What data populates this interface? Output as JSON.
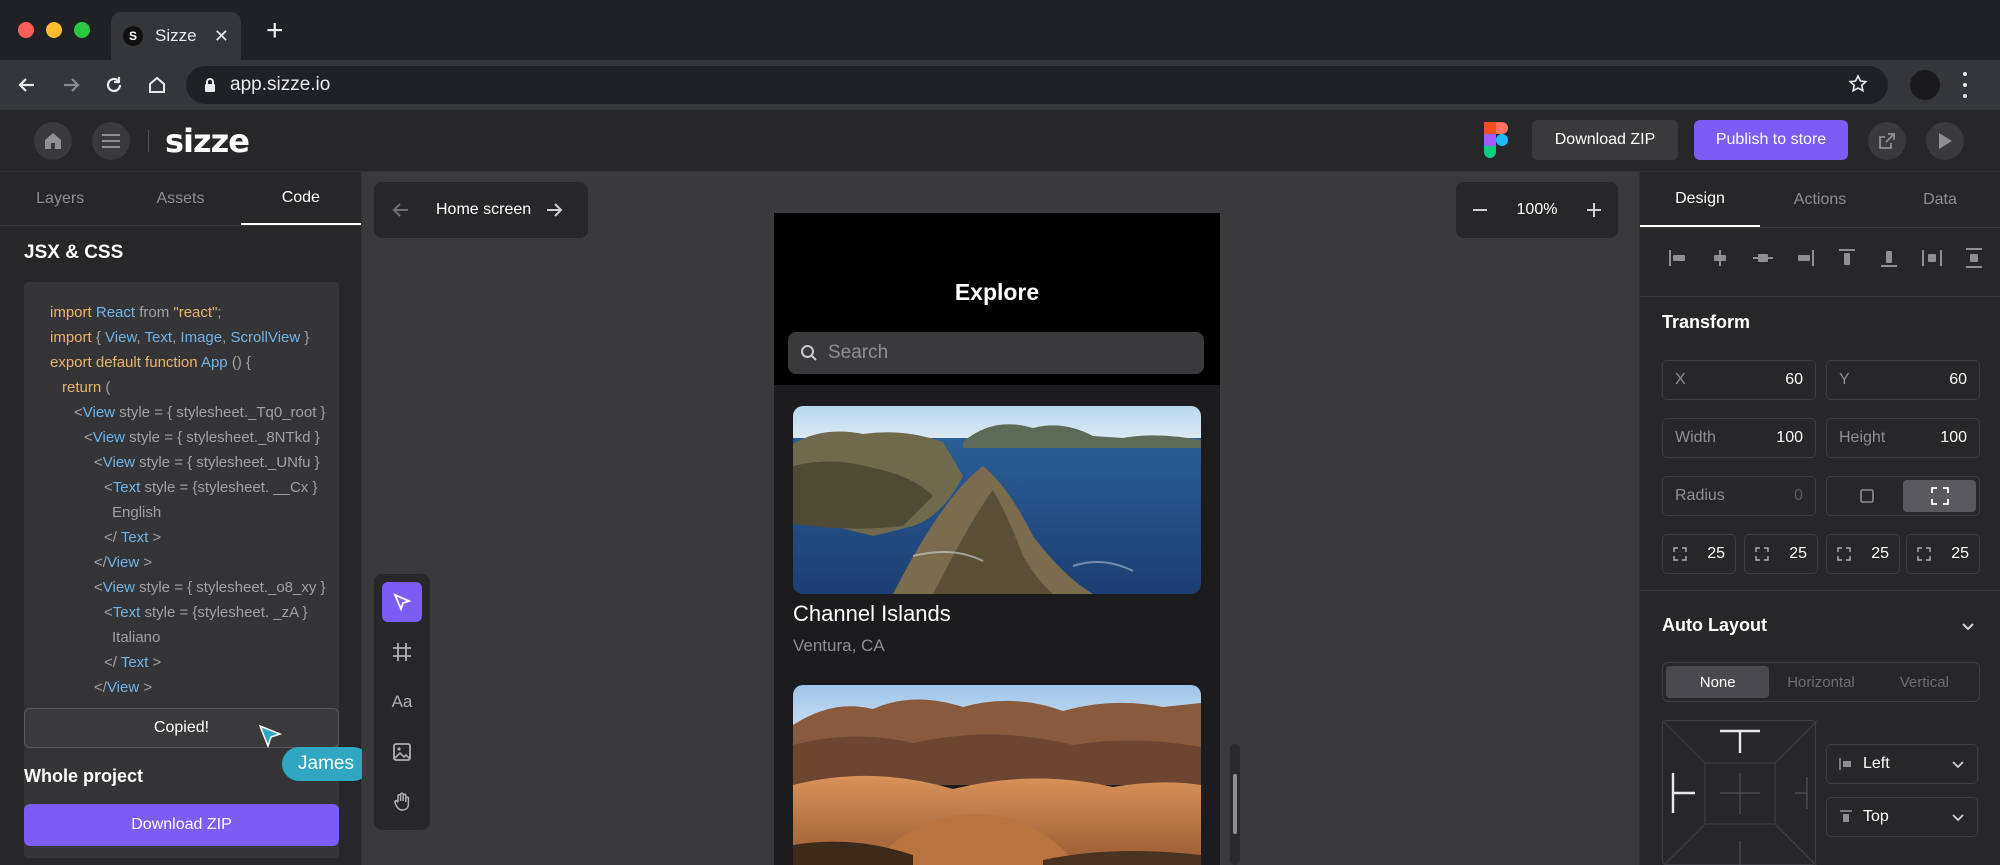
{
  "browser": {
    "tab_title": "Sizze",
    "tab_favicon": "S",
    "url": "app.sizze.io"
  },
  "header": {
    "logo": "sizze",
    "download_zip": "Download ZIP",
    "publish": "Publish to store",
    "accent_color": "#7b5cf5"
  },
  "left_panel": {
    "tabs": [
      "Layers",
      "Assets",
      "Code"
    ],
    "active_tab": "Code",
    "heading": "JSX & CSS",
    "copied_label": "Copied!",
    "collaborator": "James",
    "whole_project_heading": "Whole project",
    "download_zip": "Download ZIP"
  },
  "canvas": {
    "screen_name": "Home screen",
    "zoom": "100%"
  },
  "phone": {
    "title": "Explore",
    "search_placeholder": "Search",
    "cards": [
      {
        "title": "Channel Islands",
        "subtitle": "Ventura, CA"
      }
    ]
  },
  "right_panel": {
    "tabs": [
      "Design",
      "Actions",
      "Data"
    ],
    "active_tab": "Design",
    "transform_heading": "Transform",
    "x_label": "X",
    "x_value": "60",
    "y_label": "Y",
    "y_value": "60",
    "width_label": "Width",
    "width_value": "100",
    "height_label": "Height",
    "height_value": "100",
    "radius_label": "Radius",
    "radius_value": "0",
    "corner_values": [
      "25",
      "25",
      "25",
      "25"
    ],
    "auto_layout_heading": "Auto Layout",
    "layout_modes": [
      "None",
      "Horizontal",
      "Vertical"
    ],
    "active_layout_mode": "None",
    "h_align": "Left",
    "v_align": "Top"
  }
}
